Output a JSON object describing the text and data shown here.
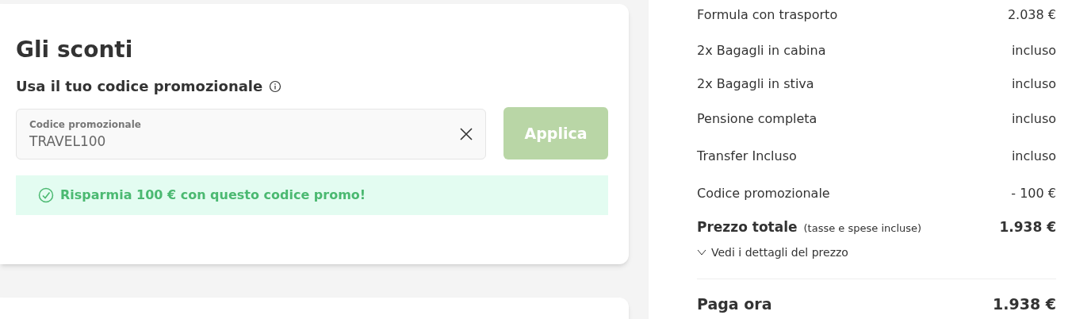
{
  "discounts": {
    "title": "Gli sconti",
    "subtitle": "Usa il tuo codice promozionale",
    "promo_field": {
      "label": "Codice promozionale",
      "value": "TRAVEL100"
    },
    "apply_button": {
      "label": "Applica",
      "disabled": true
    },
    "success_message": "Risparmia 100 € con questo codice promo!"
  },
  "summary": {
    "rows": [
      {
        "label": "Formula con trasporto",
        "value": "2.038 €"
      },
      {
        "label": "2x Bagagli in cabina",
        "value": "incluso"
      },
      {
        "label": "2x Bagagli in stiva",
        "value": "incluso"
      },
      {
        "label": "Pensione completa",
        "value": "incluso"
      },
      {
        "label": "Transfer Incluso",
        "value": "incluso"
      },
      {
        "label": "Codice promozionale",
        "value": "- 100 €"
      }
    ],
    "total": {
      "label": "Prezzo totale",
      "note": "(tasse e spese incluse)",
      "value": "1.938 €"
    },
    "details_link": {
      "label": "Vedi i dettagli del prezzo",
      "expanded": false
    },
    "pay_now": {
      "label": "Paga ora",
      "value": "1.938 €"
    }
  }
}
